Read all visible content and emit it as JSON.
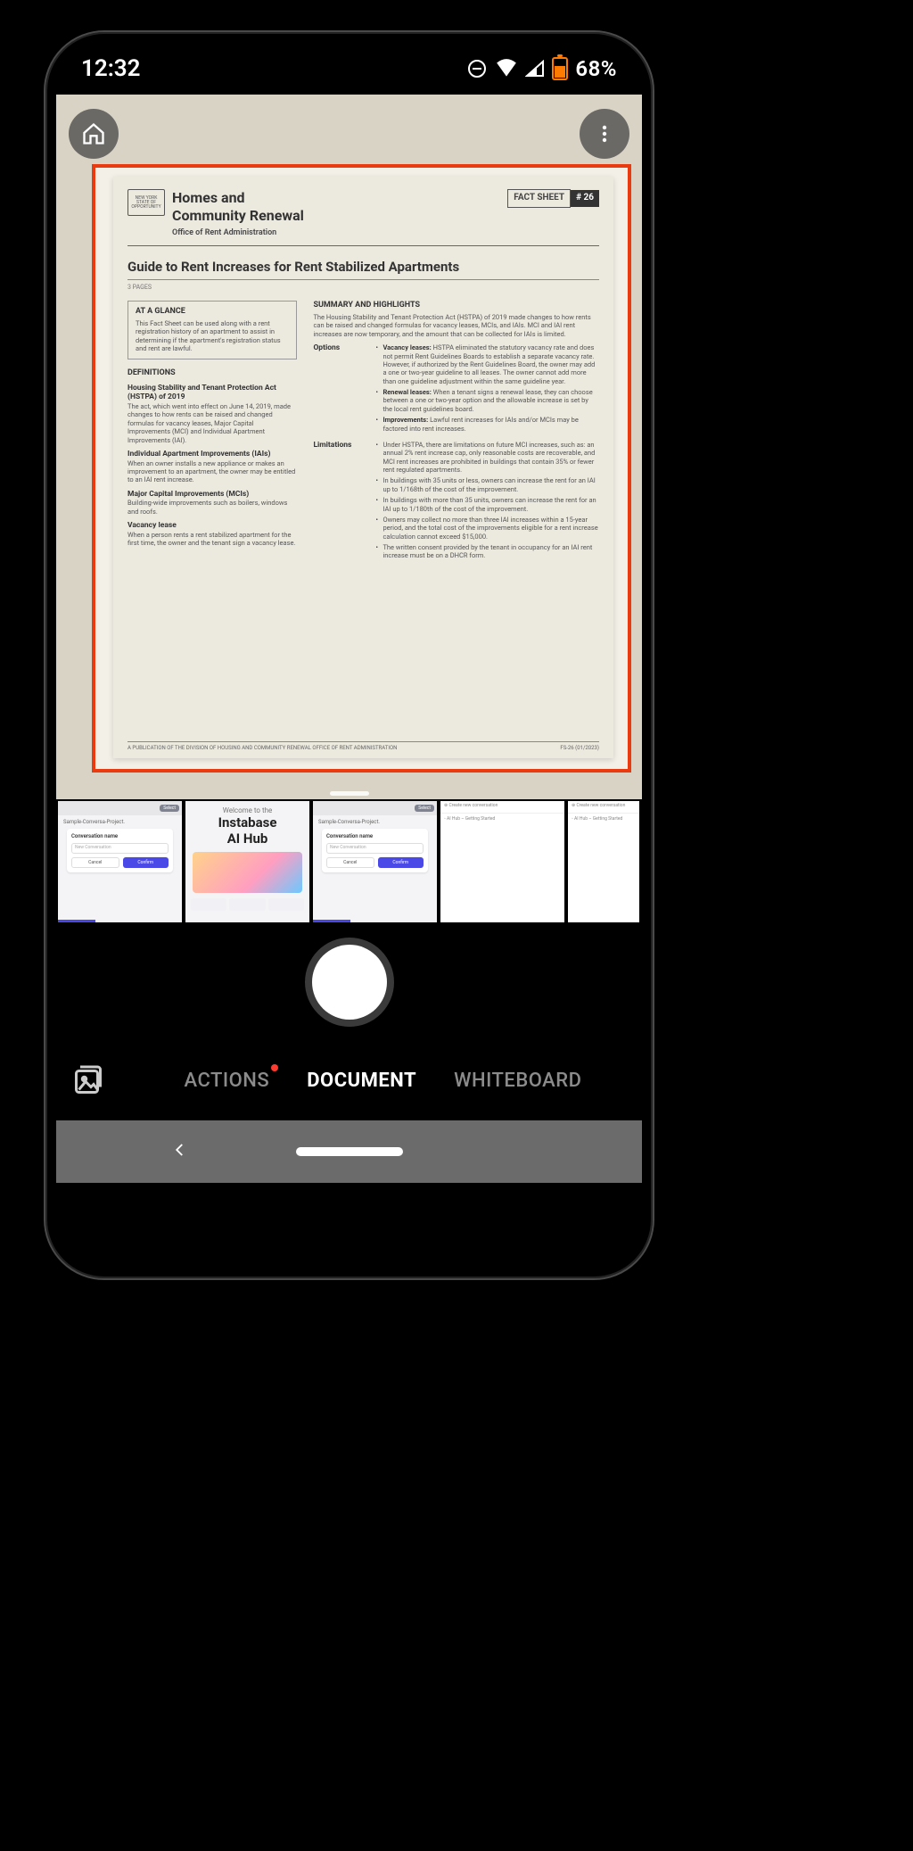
{
  "status_bar": {
    "time": "12:32",
    "battery_pct": "68%"
  },
  "document": {
    "ny_state": "NEW YORK STATE OF OPPORTUNITY",
    "agency_line1": "Homes and",
    "agency_line2": "Community Renewal",
    "office": "Office of Rent Administration",
    "factsheet_label": "FACT SHEET",
    "factsheet_num": "# 26",
    "title": "Guide to Rent Increases for Rent Stabilized Apartments",
    "pages": "3 PAGES",
    "at_a_glance_head": "AT A GLANCE",
    "at_a_glance_body": "This Fact Sheet can be used along with a rent registration history of an apartment to assist in determining if the apartment's registration status and rent are lawful.",
    "definitions_head": "DEFINITIONS",
    "def_hstpa_term": "Housing Stability and Tenant Protection Act (HSTPA) of 2019",
    "def_hstpa_body": "The act, which went into effect on June 14, 2019, made changes to how rents can be raised and changed formulas for vacancy leases, Major Capital Improvements (MCI) and Individual Apartment Improvements (IAI).",
    "def_iai_term": "Individual Apartment Improvements (IAIs)",
    "def_iai_body": "When an owner installs a new appliance or makes an improvement to an apartment, the owner may be entitled to an IAI rent increase.",
    "def_mci_term": "Major Capital Improvements (MCIs)",
    "def_mci_body": "Building-wide improvements such as boilers, windows and roofs.",
    "def_vac_term": "Vacancy lease",
    "def_vac_body": "When a person rents a rent stabilized apartment for the first time, the owner and the tenant sign a vacancy lease.",
    "summary_head": "SUMMARY AND HIGHLIGHTS",
    "summary_body": "The Housing Stability and Tenant Protection Act (HSTPA) of 2019 made changes to how rents can be raised and changed formulas for vacancy leases, MCIs, and IAIs. MCI and IAI rent increases are now temporary, and the amount that can be collected for IAIs is limited.",
    "options_label": "Options",
    "limitations_label": "Limitations",
    "opt_vacancy_head": "Vacancy leases:",
    "opt_vacancy_body": "HSTPA eliminated the statutory vacancy rate and does not permit Rent Guidelines Boards to establish a separate vacancy rate. However, if authorized by the Rent Guidelines Board, the owner may add a one or two-year guideline to all leases. The owner cannot add more than one guideline adjustment within the same guideline year.",
    "opt_renewal_head": "Renewal leases:",
    "opt_renewal_body": "When a tenant signs a renewal lease, they can choose between a one or two-year option and the allowable increase is set by the local rent guidelines board.",
    "opt_improve_head": "Improvements:",
    "opt_improve_body": "Lawful rent increases for IAIs and/or MCIs may be factored into rent increases.",
    "lim_1": "Under HSTPA, there are limitations on future MCI increases, such as: an annual 2% rent increase cap, only reasonable costs are recoverable, and MCI rent increases are prohibited in buildings that contain 35% or fewer rent regulated apartments.",
    "lim_2": "In buildings with 35 units or less, owners can increase the rent for an IAI up to 1/168th of the cost of the improvement.",
    "lim_3": "In buildings with more than 35 units, owners can increase the rent for an IAI up to 1/180th of the cost of the improvement.",
    "lim_4": "Owners may collect no more than three IAI increases within a 15-year period, and the total cost of the improvements eligible for a rent increase calculation cannot exceed $15,000.",
    "lim_5": "The written consent provided by the tenant in occupancy for an IAI rent increase must be on a DHCR form.",
    "footer_left": "A PUBLICATION OF THE DIVISION OF HOUSING AND COMMUNITY RENEWAL OFFICE OF RENT ADMINISTRATION",
    "footer_right": "FS-26 (01/2023)"
  },
  "thumbs": {
    "conv_top_pill": "Select",
    "create_text": "Create new conversation",
    "project_label": "Sample-Conversa-Project.",
    "conv_name_label": "Conversation name",
    "conv_input_ph": "New Conversation",
    "cancel": "Cancel",
    "confirm": "Confirm",
    "welcome_small": "Welcome to the",
    "welcome_brand1": "Instabase",
    "welcome_brand2": "AI Hub",
    "blank_title": "AI Hub – Getting Started",
    "blank_create": "Create new conversation"
  },
  "modes": {
    "actions": "ACTIONS",
    "document": "DOCUMENT",
    "whiteboard": "WHITEBOARD"
  }
}
